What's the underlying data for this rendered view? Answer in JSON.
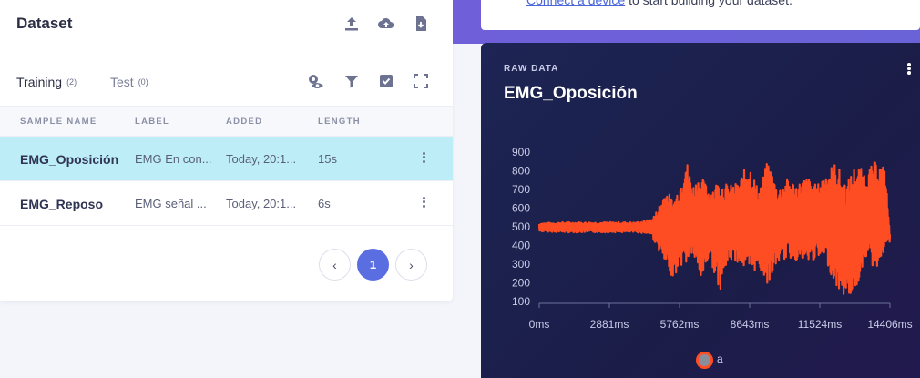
{
  "dataset": {
    "title": "Dataset",
    "header_icons": [
      "upload-icon",
      "cloud-upload-icon",
      "download-icon"
    ],
    "tabs": [
      {
        "label": "Training",
        "count": "(2)"
      },
      {
        "label": "Test",
        "count": "(0)"
      }
    ],
    "tab_icons": [
      "eye-settings-icon",
      "filter-icon",
      "checkbox-icon",
      "fullscreen-icon"
    ],
    "columns": [
      "SAMPLE NAME",
      "LABEL",
      "ADDED",
      "LENGTH"
    ],
    "rows": [
      {
        "name": "EMG_Oposición",
        "label": "EMG En con...",
        "added": "Today, 20:1...",
        "length": "15s",
        "selected": true
      },
      {
        "name": "EMG_Reposo",
        "label": "EMG señal ...",
        "added": "Today, 20:1...",
        "length": "6s",
        "selected": false
      }
    ],
    "pagination": {
      "prev": "‹",
      "current": "1",
      "next": "›"
    }
  },
  "connect": {
    "link": "Connect a device",
    "text": " to start building your dataset."
  },
  "raw_data": {
    "label": "RAW DATA",
    "title": "EMG_Oposición",
    "legend": "a",
    "series_color": "#ff4d23"
  },
  "chart_data": {
    "type": "line",
    "title": "EMG_Oposición",
    "xlabel": "",
    "ylabel": "",
    "x_ticks": [
      "0ms",
      "2881ms",
      "5762ms",
      "8643ms",
      "11524ms",
      "14406ms"
    ],
    "y_ticks": [
      100,
      200,
      300,
      400,
      500,
      600,
      700,
      800,
      900
    ],
    "xlim": [
      0,
      14406
    ],
    "ylim": [
      100,
      900
    ],
    "grid": false,
    "legend_position": "bottom",
    "series": [
      {
        "name": "a",
        "color": "#ff4d23",
        "envelope": [
          {
            "x": 0,
            "min": 475,
            "max": 520
          },
          {
            "x": 1000,
            "min": 470,
            "max": 525
          },
          {
            "x": 2000,
            "min": 470,
            "max": 525
          },
          {
            "x": 3000,
            "min": 470,
            "max": 525
          },
          {
            "x": 4000,
            "min": 470,
            "max": 525
          },
          {
            "x": 4600,
            "min": 460,
            "max": 540
          },
          {
            "x": 4800,
            "min": 400,
            "max": 580
          },
          {
            "x": 5000,
            "min": 350,
            "max": 640
          },
          {
            "x": 5200,
            "min": 280,
            "max": 710
          },
          {
            "x": 5500,
            "min": 230,
            "max": 640
          },
          {
            "x": 5900,
            "min": 300,
            "max": 780
          },
          {
            "x": 6000,
            "min": 280,
            "max": 890
          },
          {
            "x": 6300,
            "min": 360,
            "max": 720
          },
          {
            "x": 6600,
            "min": 200,
            "max": 780
          },
          {
            "x": 7000,
            "min": 340,
            "max": 700
          },
          {
            "x": 7400,
            "min": 150,
            "max": 760
          },
          {
            "x": 7800,
            "min": 320,
            "max": 720
          },
          {
            "x": 8200,
            "min": 310,
            "max": 740
          },
          {
            "x": 8600,
            "min": 230,
            "max": 860
          },
          {
            "x": 9000,
            "min": 280,
            "max": 700
          },
          {
            "x": 9400,
            "min": 190,
            "max": 860
          },
          {
            "x": 9800,
            "min": 310,
            "max": 700
          },
          {
            "x": 10200,
            "min": 330,
            "max": 760
          },
          {
            "x": 10600,
            "min": 320,
            "max": 730
          },
          {
            "x": 11000,
            "min": 300,
            "max": 770
          },
          {
            "x": 11400,
            "min": 330,
            "max": 720
          },
          {
            "x": 11800,
            "min": 310,
            "max": 800
          },
          {
            "x": 12200,
            "min": 170,
            "max": 850
          },
          {
            "x": 12600,
            "min": 120,
            "max": 730
          },
          {
            "x": 13000,
            "min": 150,
            "max": 840
          },
          {
            "x": 13400,
            "min": 340,
            "max": 790
          },
          {
            "x": 13800,
            "min": 260,
            "max": 850
          },
          {
            "x": 14200,
            "min": 380,
            "max": 820
          },
          {
            "x": 14406,
            "min": 420,
            "max": 460
          }
        ]
      }
    ]
  }
}
